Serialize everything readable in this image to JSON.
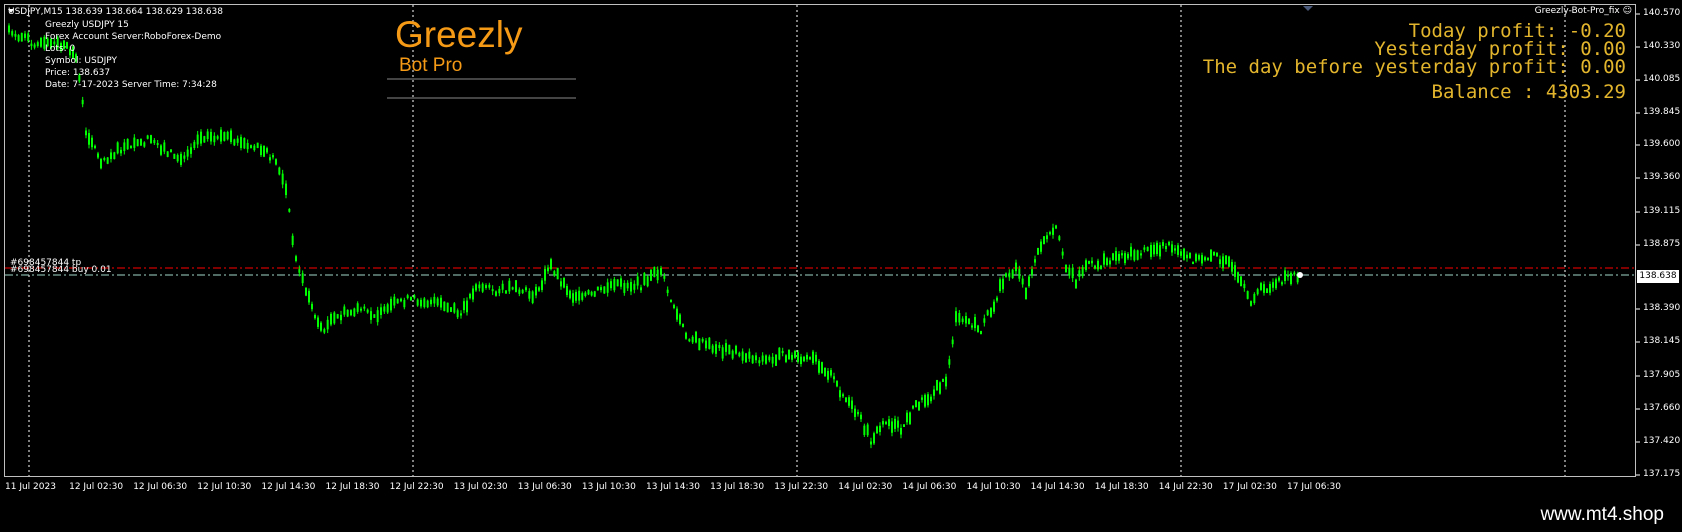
{
  "chart": {
    "symbol_header": "USDJPY,M15  138.639 138.664 138.629 138.638",
    "ea_name": "Greezly-Bot-Pro_fix",
    "ea_status_icon": "smiley-icon",
    "current_price": "138.638",
    "order_line_tp": "#698457844 tp",
    "order_line_buy": "#698457844 buy 0.01"
  },
  "info_panel": {
    "line1": "Greezly  USDJPY  15",
    "line2": "Forex Account Server:RoboForex-Demo",
    "line3": "Lots:  0",
    "line4": "Symbol: USDJPY",
    "line5": "Price:  138.637",
    "line6": "Date: 7-17-2023 Server Time: 7:34:28"
  },
  "brand": {
    "title": "Greezly",
    "subtitle": "Bot Pro"
  },
  "profits": {
    "today": "Today profit: -0.20",
    "yesterday": "Yesterday profit: 0.00",
    "day_before": "The day before yesterday profit: 0.00",
    "balance": "Balance : 4303.29"
  },
  "price_axis": [
    "140.570",
    "140.330",
    "140.085",
    "139.845",
    "139.600",
    "139.360",
    "139.115",
    "138.875",
    "138.390",
    "138.145",
    "137.905",
    "137.660",
    "137.420",
    "137.175"
  ],
  "time_axis": [
    "11 Jul 2023",
    "12 Jul 02:30",
    "12 Jul 06:30",
    "12 Jul 10:30",
    "12 Jul 14:30",
    "12 Jul 18:30",
    "12 Jul 22:30",
    "13 Jul 02:30",
    "13 Jul 06:30",
    "13 Jul 10:30",
    "13 Jul 14:30",
    "13 Jul 18:30",
    "13 Jul 22:30",
    "14 Jul 02:30",
    "14 Jul 06:30",
    "14 Jul 10:30",
    "14 Jul 14:30",
    "14 Jul 18:30",
    "14 Jul 22:30",
    "17 Jul 02:30",
    "17 Jul 06:30"
  ],
  "footer": {
    "watermark": "www.mt4.shop"
  },
  "colors": {
    "candle": "#00ff00",
    "profit_text": "#e2b52d",
    "brand": "#f59a16",
    "tp_line": "#ff0000",
    "order_line": "#a0d8c8"
  }
}
